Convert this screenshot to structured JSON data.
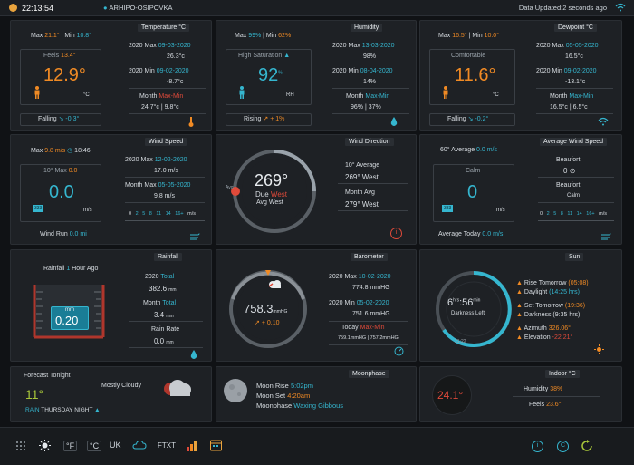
{
  "topbar": {
    "time": "22:13:54",
    "location": "ARHIPO-OSIPOVKA",
    "updated": "Data Updated:2 seconds ago"
  },
  "temperature": {
    "title": "Temperature °C",
    "max_label": "Max",
    "max": "21.1°",
    "min_label": "| Min",
    "min": "10.8°",
    "feels_label": "Feels",
    "feels": "13.4°",
    "value": "12.9°",
    "unit": "°C",
    "trend_label": "Falling",
    "trend": "-0.3°",
    "r1_label": "2020 Max",
    "r1_date": "09-03-2020",
    "r1_value": "26.3°c",
    "r2_label": "2020 Min",
    "r2_date": "09-02-2020",
    "r2_value": "-8.7°c",
    "month_label": "Month",
    "month_maxmin": "Max-Min",
    "month_value": "24.7°c | 9.8°c"
  },
  "humidity": {
    "title": "Humidity",
    "max_label": "Max",
    "max": "99%",
    "min_label": "| Min",
    "min": "62%",
    "status": "High Saturation",
    "value": "92",
    "percent": "%",
    "unit": "RH",
    "trend_label": "Rising",
    "trend": "+ 1%",
    "r1_label": "2020 Max",
    "r1_date": "13-03-2020",
    "r1_value": "98%",
    "r2_label": "2020 Min",
    "r2_date": "08-04-2020",
    "r2_value": "14%",
    "month_label": "Month",
    "month_maxmin": "Max-Min",
    "month_value": "96% | 37%"
  },
  "dewpoint": {
    "title": "Dewpoint °C",
    "max_label": "Max",
    "max": "16.5°",
    "min_label": "| Min",
    "min": "10.0°",
    "status": "Comfortable",
    "value": "11.6°",
    "unit": "°C",
    "trend_label": "Falling",
    "trend": "-0.2°",
    "r1_label": "2020 Max",
    "r1_date": "05-05-2020",
    "r1_value": "16.5°c",
    "r2_label": "2020 Min",
    "r2_date": "09-02-2020",
    "r2_value": "-13.1°c",
    "month_label": "Month",
    "month_maxmin": "Max-Min",
    "month_value": "16.5°c | 6.5°c"
  },
  "wind_speed": {
    "title": "Wind Speed",
    "max_label": "Max",
    "max": "9.8",
    "max_unit": "m/s",
    "time": "18:46",
    "avg_label": "10° Max",
    "avg_value": "0.0",
    "value": "0.0",
    "unit": "m/s",
    "badge": "333",
    "r1_label": "2020 Max",
    "r1_date": "12-02-2020",
    "r1_value": "17.0 m/s",
    "r2_label": "Month Max",
    "r2_date": "05-05-2020",
    "r2_value": "9.8 m/s",
    "scale": [
      "0",
      "2",
      "5",
      "8",
      "11",
      "14",
      "16+",
      "m/s"
    ],
    "run_label": "Wind Run",
    "run_value": "0.0",
    "run_unit": "mi"
  },
  "wind_direction": {
    "title": "Wind Direction",
    "avg_text": "Avg",
    "value": "269°",
    "due_label": "Due",
    "due": "West",
    "avg": "Avg West",
    "ten_label": "10° Average",
    "ten_value": "269°  West",
    "month_label": "Month Avg",
    "month_value": "279°  West"
  },
  "avg_wind": {
    "title": "Average Wind Speed",
    "header_label": "60° Average",
    "header_value": "0.0 m/s",
    "status": "Calm",
    "value": "0",
    "unit": "m/s",
    "badge": "333",
    "beaufort_label": "Beaufort",
    "beaufort_value": "0",
    "beaufort2_label": "Beaufort",
    "beaufort2_value": "Calm",
    "scale": [
      "0",
      "2",
      "5",
      "8",
      "11",
      "14",
      "16+",
      "m/s"
    ],
    "today_label": "Average Today",
    "today_value": "0.0 m/s"
  },
  "rainfall": {
    "title": "Rainfall",
    "hour_label": "Rainfall",
    "hour_num": "1",
    "hour_label2": "Hour Ago",
    "gauge_unit": "mm",
    "gauge_value": "0.20",
    "total_label": "2020",
    "total_word": "Total",
    "total_value": "382.6",
    "total_unit": "mm",
    "month_label": "Month",
    "month_word": "Total",
    "month_value": "3.4",
    "month_unit": "mm",
    "rate_label": "Rain Rate",
    "rate_value": "0.0",
    "rate_unit": "mm"
  },
  "barometer": {
    "title": "Barometer",
    "value": "758.3",
    "unit": "mmHG",
    "trend": "+ 0.10",
    "r1_label": "2020 Max",
    "r1_date": "10-02-2020",
    "r1_value": "774.8 mmHG",
    "r2_label": "2020 Min",
    "r2_date": "05-02-2020",
    "r2_value": "751.6 mmHG",
    "today_label": "Today",
    "today_maxmin": "Max-Min",
    "today_value": "759.1mmHG | 757.2mmHG"
  },
  "sun": {
    "title": "Sun",
    "hrs": "6",
    "hrs_unit": "hrs",
    "min": "56",
    "min_unit": "min",
    "darkness": "Darkness Left",
    "rise_label": "Rise Tomorrow",
    "rise_value": "(05:08)",
    "daylight_label": "Daylight",
    "daylight_value": "(14:25 hrs)",
    "set_label": "Set Tomorrow",
    "set_value": "(19:36)",
    "dark_label": "Darkness",
    "dark_value": "(9:35 hrs)",
    "azimuth_label": "Azimuth",
    "azimuth_value": "326.06°",
    "elev_label": "Elevation",
    "elev_value": "-22.21°",
    "arc_label": "21:22"
  },
  "forecast": {
    "title": "Forecast Tonight",
    "temp": "11°",
    "condition": "Mostly Cloudy",
    "rain_label": "RAIN",
    "rain_value": "THURSDAY NIGHT"
  },
  "moonphase": {
    "title": "Moonphase",
    "rise_label": "Moon Rise",
    "rise_value": "5:02pm",
    "set_label": "Moon Set",
    "set_value": "4:20am",
    "phase_label": "Moonphase",
    "phase_value": "Waxing Gibbous"
  },
  "indoor": {
    "title": "Indoor °C",
    "value": "24.1°",
    "hum_label": "Humidity",
    "hum_value": "38%",
    "feels_label": "Feels",
    "feels_value": "23.6°"
  },
  "bottombar": {
    "f": "°F",
    "c": "°C",
    "uk": "UK",
    "ftxt": "FTXT",
    "i": "i",
    "c_icon": "C"
  }
}
